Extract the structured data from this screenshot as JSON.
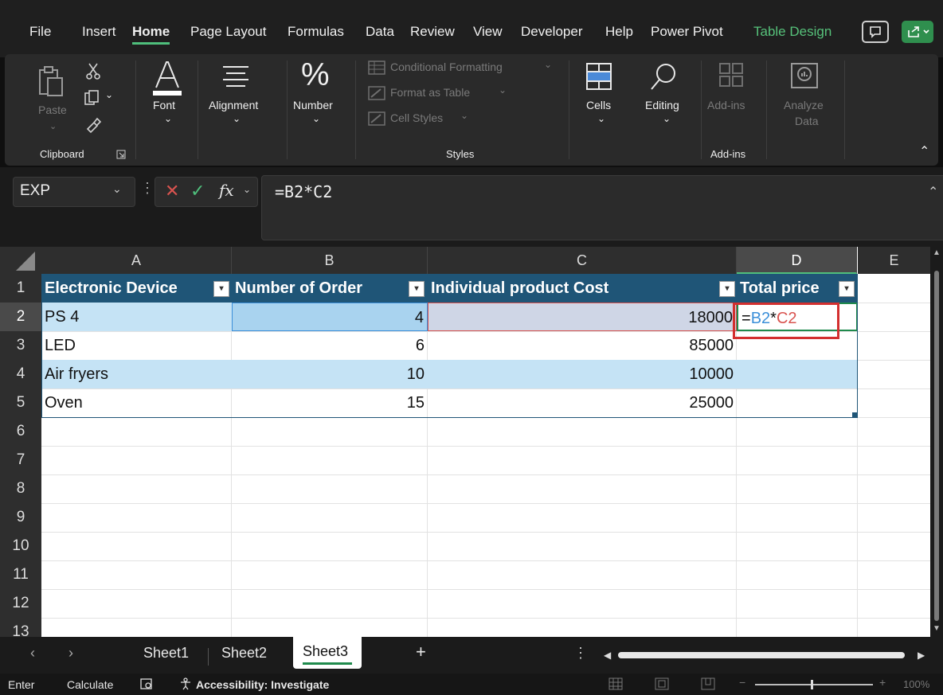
{
  "menu": {
    "items": [
      "File",
      "Insert",
      "Home",
      "Page Layout",
      "Formulas",
      "Data",
      "Review",
      "View",
      "Developer",
      "Help",
      "Power Pivot",
      "Table Design"
    ]
  },
  "ribbon": {
    "paste": "Paste",
    "clipboard": "Clipboard",
    "font": "Font",
    "alignment": "Alignment",
    "number": "Number",
    "conditional_formatting": "Conditional Formatting",
    "format_as_table": "Format as Table",
    "cell_styles": "Cell Styles",
    "styles": "Styles",
    "cells": "Cells",
    "editing": "Editing",
    "add_ins_button": "Add-ins",
    "analyze_1": "Analyze",
    "analyze_2": "Data",
    "add_ins_group": "Add-ins"
  },
  "formula_bar": {
    "name_box": "EXP",
    "fx": "fx",
    "formula": "=B2*C2"
  },
  "sheet": {
    "columns": [
      "A",
      "B",
      "C",
      "D",
      "E"
    ],
    "rows": [
      "1",
      "2",
      "3",
      "4",
      "5",
      "6",
      "7",
      "8",
      "9",
      "10",
      "11",
      "12",
      "13"
    ],
    "headers": [
      "Electronic Device",
      "Number of Order",
      "Individual product Cost",
      "Total price"
    ],
    "data": [
      {
        "device": "PS 4",
        "orders": "4",
        "cost": "18000"
      },
      {
        "device": "LED",
        "orders": "6",
        "cost": "85000"
      },
      {
        "device": "Air fryers",
        "orders": "10",
        "cost": "10000"
      },
      {
        "device": "Oven",
        "orders": "15",
        "cost": "25000"
      }
    ],
    "edit_eq": "=",
    "edit_ref1": "B2",
    "edit_op": "*",
    "edit_ref2": "C2"
  },
  "tabs": {
    "sheet1": "Sheet1",
    "sheet2": "Sheet2",
    "sheet3": "Sheet3",
    "add": "+"
  },
  "status": {
    "mode": "Enter",
    "calculate": "Calculate",
    "accessibility": "Accessibility: Investigate",
    "zoom": "100%"
  },
  "colors": {
    "accent_green": "#4fbf7c",
    "table_header": "#1f5577",
    "band": "#c5e3f5",
    "ref_blue": "#3b8fd9",
    "ref_red": "#d9534f"
  }
}
